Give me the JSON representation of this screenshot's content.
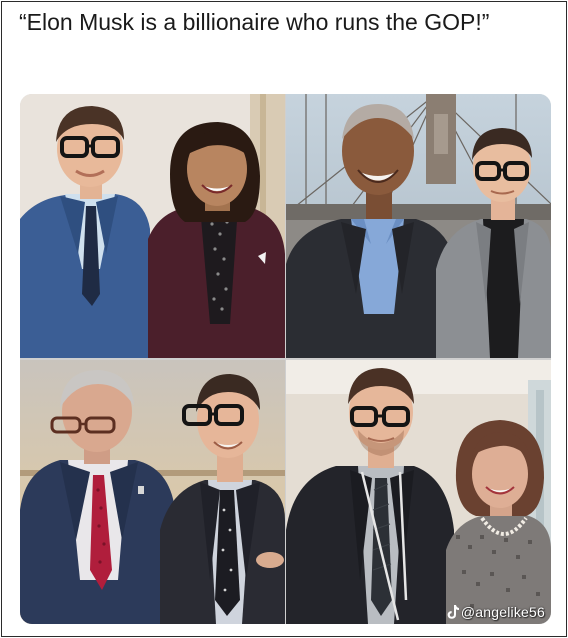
{
  "caption": "“Elon Musk is a billionaire who runs the GOP!”",
  "watermark": {
    "icon": "tiktok-logo-icon",
    "handle": "@angelike56"
  },
  "photos": [
    {
      "name": "photo-top-left"
    },
    {
      "name": "photo-top-right"
    },
    {
      "name": "photo-bottom-left"
    },
    {
      "name": "photo-bottom-right"
    }
  ],
  "colors": {
    "text": "#1a1a1a",
    "border": "#2b2b2b",
    "background": "#ffffff"
  }
}
